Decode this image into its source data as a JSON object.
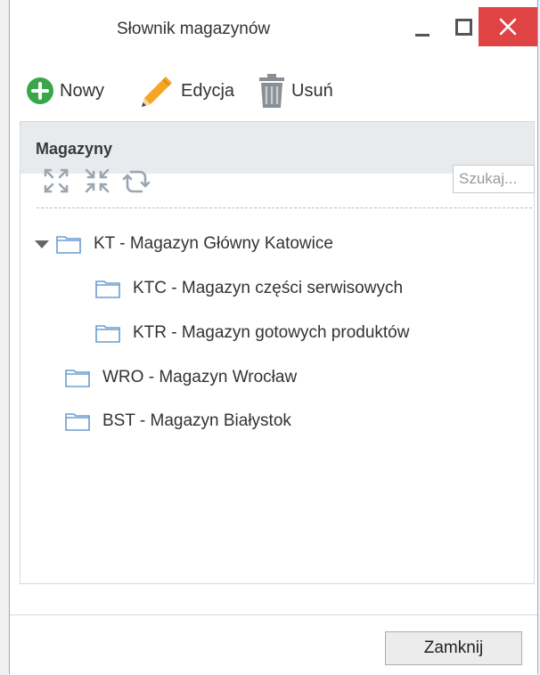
{
  "window": {
    "title": "Słownik magazynów"
  },
  "toolbar": {
    "new_label": "Nowy",
    "edit_label": "Edycja",
    "delete_label": "Usuń"
  },
  "panel": {
    "title": "Magazyny",
    "search_placeholder": "Szukaj..."
  },
  "tree": [
    {
      "label": "KT - Magazyn Główny Katowice",
      "level": 0,
      "expanded": true
    },
    {
      "label": "KTC - Magazyn części serwisowych",
      "level": 1
    },
    {
      "label": "KTR - Magazyn gotowych produktów",
      "level": 1
    },
    {
      "label": "WRO - Magazyn Wrocław",
      "level": 0
    },
    {
      "label": "BST - Magazyn Białystok",
      "level": 0
    }
  ],
  "footer": {
    "close_label": "Zamknij"
  },
  "colors": {
    "accent_green": "#3aa64a",
    "close_red": "#e04343",
    "folder_blue": "#6c9dcf",
    "pencil_orange": "#f5a623"
  },
  "icons": {
    "new": "plus-circle-icon",
    "edit": "pencil-icon",
    "delete": "trash-icon",
    "expand_all": "expand-icon",
    "collapse_all": "collapse-icon",
    "refresh": "refresh-icon",
    "folder": "folder-icon"
  }
}
